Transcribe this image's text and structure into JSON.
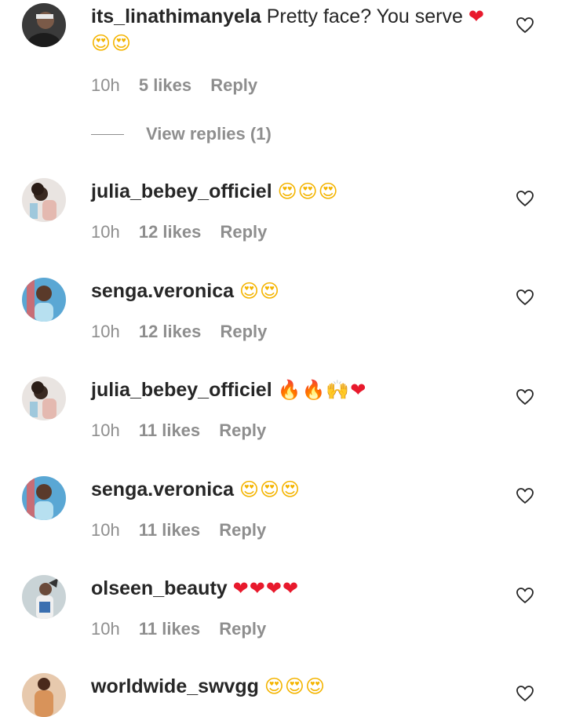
{
  "comments": [
    {
      "username": "its_linathimanyela",
      "text": "Pretty face? You serve",
      "emojis": "❤😍😍",
      "time": "10h",
      "likes": "5 likes",
      "reply": "Reply",
      "view_replies": "View replies (1)",
      "avatar_color": "#3a3a3a"
    },
    {
      "username": "julia_bebey_officiel",
      "text": "",
      "emojis": "😍😍😍",
      "time": "10h",
      "likes": "12 likes",
      "reply": "Reply",
      "avatar_color": "#d9cfc9"
    },
    {
      "username": "senga.veronica",
      "text": "",
      "emojis": "😍😍",
      "time": "10h",
      "likes": "12 likes",
      "reply": "Reply",
      "avatar_color": "#4fa3d6"
    },
    {
      "username": "julia_bebey_officiel",
      "text": "",
      "emojis": "🔥🔥🙌❤",
      "time": "10h",
      "likes": "11 likes",
      "reply": "Reply",
      "avatar_color": "#d9cfc9"
    },
    {
      "username": "senga.veronica",
      "text": "",
      "emojis": "😍😍😍",
      "time": "10h",
      "likes": "11 likes",
      "reply": "Reply",
      "avatar_color": "#4fa3d6"
    },
    {
      "username": "olseen_beauty",
      "text": "",
      "emojis": "❤❤❤❤",
      "time": "10h",
      "likes": "11 likes",
      "reply": "Reply",
      "avatar_color": "#9bb0b8"
    },
    {
      "username": "worldwide_swvgg",
      "text": "",
      "emojis": "😍😍😍",
      "avatar_color": "#d8935a"
    }
  ]
}
